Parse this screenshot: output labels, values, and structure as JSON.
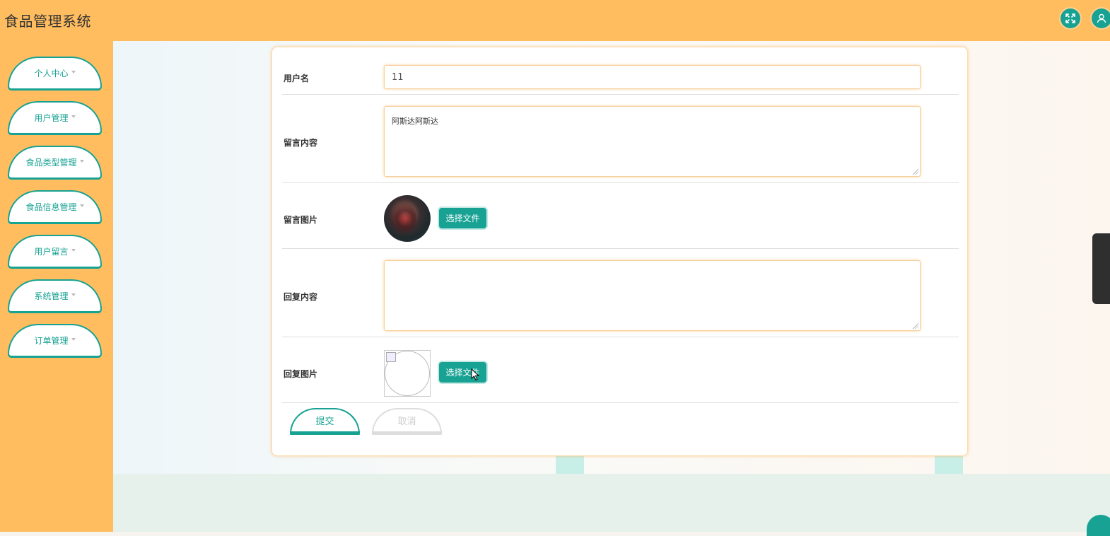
{
  "header": {
    "title": "食品管理系统",
    "fullscreen_icon": "expand-icon",
    "user_icon": "user-icon"
  },
  "sidebar": {
    "items": [
      {
        "label": "个人中心"
      },
      {
        "label": "用户管理"
      },
      {
        "label": "食品类型管理"
      },
      {
        "label": "食品信息管理"
      },
      {
        "label": "用户留言"
      },
      {
        "label": "系统管理"
      },
      {
        "label": "订单管理"
      }
    ]
  },
  "form": {
    "username": {
      "label": "用户名",
      "value": "11"
    },
    "message_content": {
      "label": "留言内容",
      "value": "阿斯达阿斯达"
    },
    "message_image": {
      "label": "留言图片",
      "button": "选择文件"
    },
    "reply_content": {
      "label": "回复内容",
      "value": ""
    },
    "reply_image": {
      "label": "回复图片",
      "button": "选择文件"
    },
    "submit_label": "提交",
    "cancel_label": "取消"
  },
  "colors": {
    "accent": "#17a293",
    "header": "#ffbd5f"
  }
}
